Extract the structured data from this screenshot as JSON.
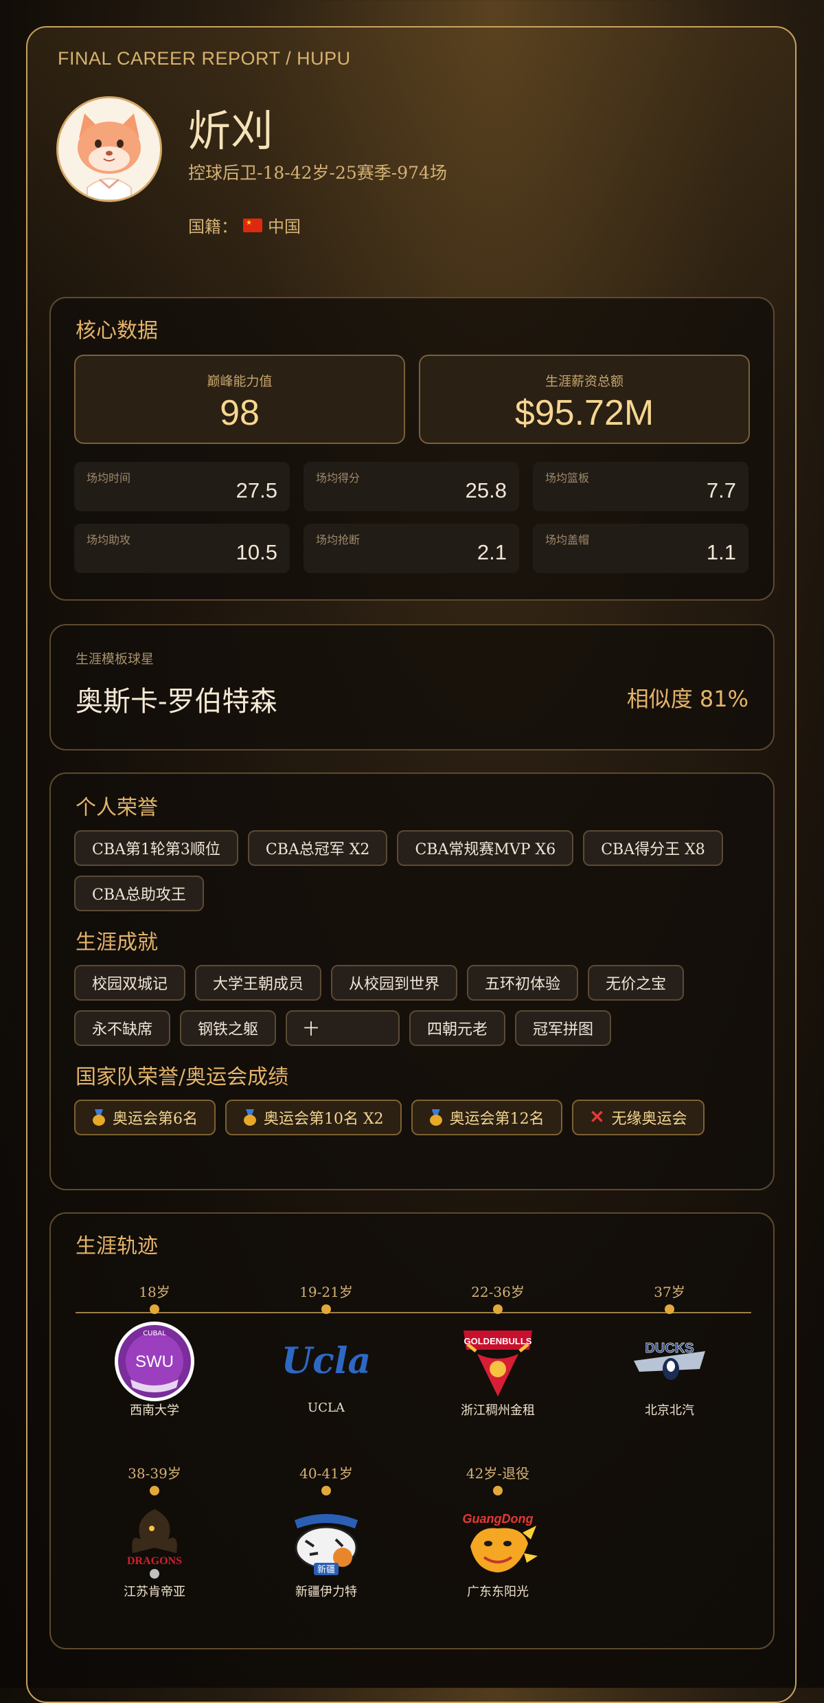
{
  "header": {
    "report_label": "FINAL CAREER REPORT / HUPU",
    "name": "炘刈",
    "subtitle": "控球后卫-18-42岁-25赛季-974场",
    "nationality_label": "国籍：",
    "nationality": "中国"
  },
  "core": {
    "title": "核心数据",
    "peak_label": "巅峰能力值",
    "peak_value": "98",
    "salary_label": "生涯薪资总额",
    "salary_value": "$95.72M",
    "stats": [
      {
        "label": "场均时间",
        "value": "27.5"
      },
      {
        "label": "场均得分",
        "value": "25.8"
      },
      {
        "label": "场均篮板",
        "value": "7.7"
      },
      {
        "label": "场均助攻",
        "value": "10.5"
      },
      {
        "label": "场均抢断",
        "value": "2.1"
      },
      {
        "label": "场均盖帽",
        "value": "1.1"
      }
    ]
  },
  "template": {
    "label": "生涯模板球星",
    "player": "奥斯卡-罗伯特森",
    "similarity": "相似度 81%"
  },
  "honors": {
    "personal_title": "个人荣誉",
    "personal": [
      "CBA第1轮第3顺位",
      "CBA总冠军 X2",
      "CBA常规赛MVP X6",
      "CBA得分王 X8",
      "CBA总助攻王"
    ],
    "achievements_title": "生涯成就",
    "achievements": [
      "校园双城记",
      "大学王朝成员",
      "从校园到世界",
      "五环初体验",
      "无价之宝",
      "永不缺席",
      "钢铁之躯",
      "十",
      "四朝元老",
      "冠军拼图"
    ],
    "national_title": "国家队荣誉/奥运会成绩",
    "national": [
      "奥运会第6名",
      "奥运会第10名 X2",
      "奥运会第12名",
      "无缘奥运会"
    ]
  },
  "trajectory": {
    "title": "生涯轨迹",
    "stops": [
      {
        "age": "18岁",
        "team": "西南大学",
        "logo_text": "SWU"
      },
      {
        "age": "19-21岁",
        "team": "UCLA",
        "logo_text": "Ucla"
      },
      {
        "age": "22-36岁",
        "team": "浙江稠州金租",
        "logo_text": "GOLDENBULLS"
      },
      {
        "age": "37岁",
        "team": "北京北汽",
        "logo_text": "DUCKS"
      },
      {
        "age": "38-39岁",
        "team": "江苏肯帝亚",
        "logo_text": "DRAGONS"
      },
      {
        "age": "40-41岁",
        "team": "新疆伊力特",
        "logo_text": "新疆"
      },
      {
        "age": "42岁-退役",
        "team": "广东东阳光",
        "logo_text": "GuangDong"
      }
    ]
  }
}
